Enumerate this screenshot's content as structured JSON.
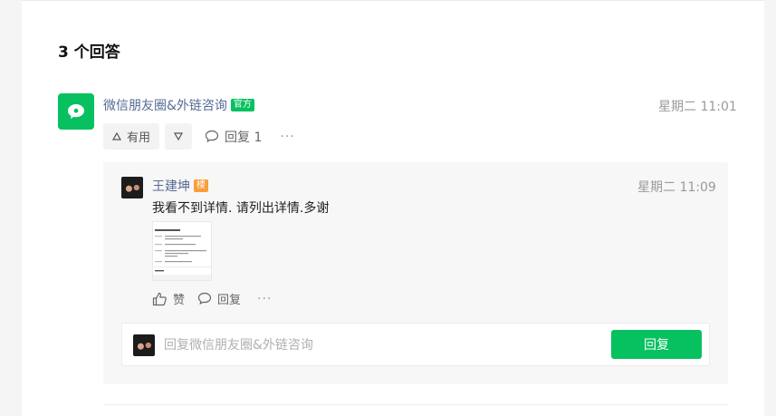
{
  "heading": "3 个回答",
  "answer": {
    "author": "微信朋友圈&外链咨询",
    "official_badge": "官方",
    "time": "星期二 11:01",
    "useful_label": "有用",
    "reply_label": "回复 1",
    "more_label": "···"
  },
  "comment": {
    "author": "王建坤",
    "floor_badge": "楼",
    "time": "星期二 11:09",
    "text": "我看不到详情. 请列出详情.多谢",
    "like_label": "赞",
    "reply_label": "回复",
    "more_label": "···"
  },
  "reply_box": {
    "placeholder": "回复微信朋友圈&外链咨询",
    "submit_label": "回复"
  },
  "colors": {
    "accent": "#07c160",
    "link": "#576b95",
    "floor_badge": "#fa9d3b"
  }
}
